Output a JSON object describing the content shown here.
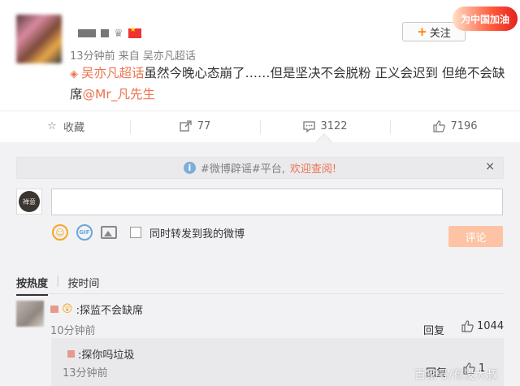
{
  "post": {
    "time": "13分钟前",
    "via_prefix": "来自",
    "source": "吴亦凡超话",
    "follow_label": "关注",
    "badge_text": "为中国加油",
    "content": {
      "topic_link": "吴亦凡超话",
      "text": "虽然今晚心态崩了……但是坚决不会脱粉  正义会迟到  但绝不会缺席",
      "mention": "@Mr_凡先生"
    }
  },
  "actions": [
    {
      "label": "收藏",
      "icon": "star-icon"
    },
    {
      "label": "77",
      "icon": "share-icon"
    },
    {
      "label": "3122",
      "icon": "comment-icon"
    },
    {
      "label": "7196",
      "icon": "thumbs-up-icon"
    }
  ],
  "notice": {
    "text": "#微博辟谣#平台,",
    "highlight": "欢迎查阅!",
    "close": "×"
  },
  "composer": {
    "avatar_text": "禅意",
    "input_value": "",
    "repost_label": "同时转发到我的微博",
    "submit_label": "评论"
  },
  "sort": {
    "hot": "按热度",
    "time": "按时间"
  },
  "comments": [
    {
      "text": ":探监不会缺席",
      "time": "10分钟前",
      "reply_label": "回复",
      "likes": "1044",
      "replies": [
        {
          "text": ":探你吗垃圾",
          "time": "13分钟前",
          "reply_label": "回复",
          "likes": "1"
        }
      ]
    }
  ],
  "watermark": "百家号/有没大叔",
  "colors": {
    "accent": "#eb7350",
    "follow_plus": "#ff8200",
    "submit_disabled": "#fdc3a4",
    "comment_bg": "#f2f2f5"
  }
}
